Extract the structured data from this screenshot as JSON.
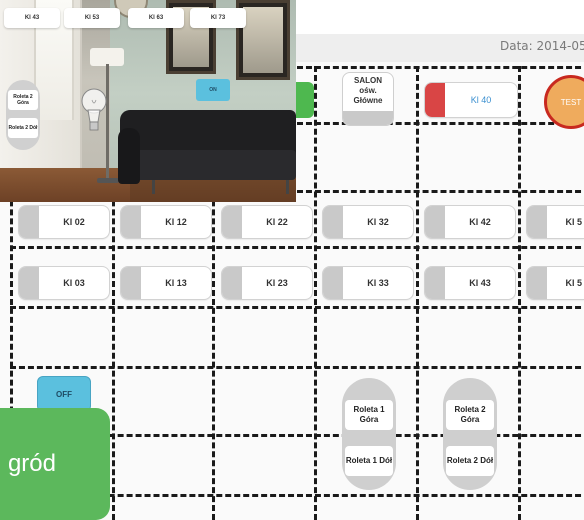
{
  "header": {
    "date_label": "Data: 2014-05-"
  },
  "photo_panel": {
    "switches": [
      "Kl 43",
      "Kl 53",
      "Kl 63",
      "Kl 73"
    ],
    "on_label": "ON",
    "roleta": {
      "up": "Roleta 2 Góra",
      "down": "Roleta 2 Dół"
    }
  },
  "tiles": {
    "salon": "SALON\nośw.\nGłówne",
    "kl40": "Kl 40",
    "test": "TEST",
    "off": "OFF",
    "ogrod": "gród"
  },
  "switch_rows": [
    {
      "y": "02",
      "labels": [
        "Kl 02",
        "Kl 12",
        "Kl 22",
        "Kl 32",
        "Kl 42",
        "Kl 5"
      ]
    },
    {
      "y": "03",
      "labels": [
        "Kl 03",
        "Kl 13",
        "Kl 23",
        "Kl 33",
        "Kl 43",
        "Kl 5"
      ]
    }
  ],
  "roleta1": {
    "up": "Roleta 1 Góra",
    "down": "Roleta 1 Dół"
  },
  "roleta2": {
    "up": "Roleta 2 Góra",
    "down": "Roleta 2 Dół"
  },
  "colors": {
    "accent_green": "#5cb85c",
    "info_blue": "#5bc0de",
    "alarm_red": "#d94545",
    "test_orange": "#efab5d"
  }
}
